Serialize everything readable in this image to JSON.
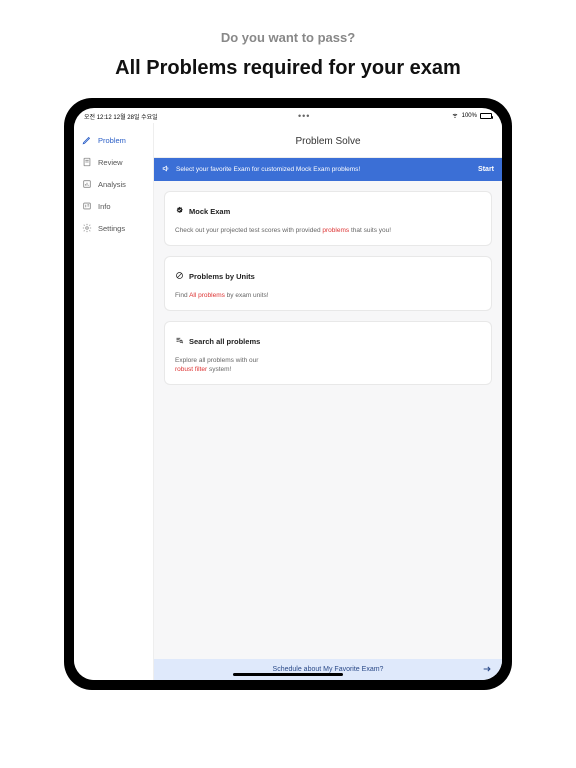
{
  "marketing": {
    "subtitle": "Do you want to pass?",
    "title": "All Problems required for your exam"
  },
  "statusbar": {
    "time": "오전 12:12",
    "date": "12월 28일 수요일",
    "battery": "100%"
  },
  "sidebar": {
    "items": [
      {
        "label": "Problem",
        "active": true
      },
      {
        "label": "Review",
        "active": false
      },
      {
        "label": "Analysis",
        "active": false
      },
      {
        "label": "Info",
        "active": false
      },
      {
        "label": "Settings",
        "active": false
      }
    ]
  },
  "main": {
    "header_title": "Problem Solve",
    "banner": {
      "text": "Select your favorite Exam for customized Mock Exam problems!",
      "action": "Start"
    },
    "cards": {
      "mock": {
        "title": "Mock Exam",
        "body_pre": "Check out your projected test scores with provided ",
        "body_hl": "problems",
        "body_post": " that suits you!"
      },
      "units": {
        "title": "Problems by Units",
        "body_pre": "Find ",
        "body_hl": "All problems",
        "body_post": " by exam units!"
      },
      "search": {
        "title": "Search all problems",
        "body_line1": "Explore all problems with our",
        "body_hl": "robust filter",
        "body_post": " system!"
      }
    },
    "bottom_banner": "Schedule about My Favorite Exam?"
  }
}
